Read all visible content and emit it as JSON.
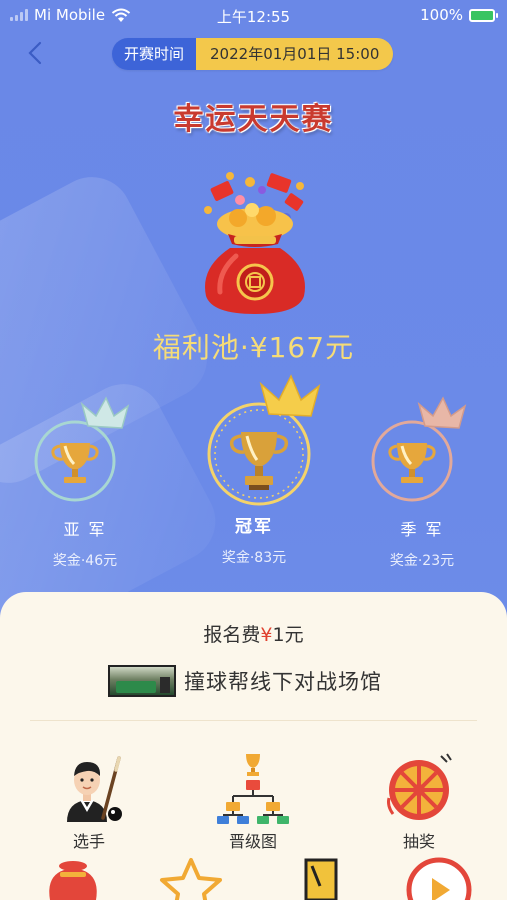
{
  "status_bar": {
    "carrier": "Mi Mobile",
    "time": "上午12:55",
    "battery": "100%"
  },
  "header": {
    "start_label": "开赛时间",
    "start_value": "2022年01月01日 15:00",
    "title": "幸运天天赛"
  },
  "pool": {
    "text": "福利池·¥167元"
  },
  "prizes": [
    {
      "rank": "亚 军",
      "amount": "奖金·46元"
    },
    {
      "rank": "冠军",
      "amount": "奖金·83元"
    },
    {
      "rank": "季 军",
      "amount": "奖金·23元"
    }
  ],
  "registration": {
    "fee_prefix": "报名费",
    "fee_yen": "¥",
    "fee_amount": "1元"
  },
  "venue": {
    "name": "撞球帮线下对战场馆"
  },
  "menu": [
    {
      "label": "选手",
      "icon": "player-icon"
    },
    {
      "label": "晋级图",
      "icon": "bracket-icon"
    },
    {
      "label": "抽奖",
      "icon": "lottery-wheel-icon"
    }
  ],
  "colors": {
    "background": "#6b89e6",
    "pill_label": "#3d64d8",
    "pill_value": "#f3c84b",
    "gold_text": "#f6dc77",
    "panel": "#fcf7eb",
    "yen": "#e0412f"
  }
}
